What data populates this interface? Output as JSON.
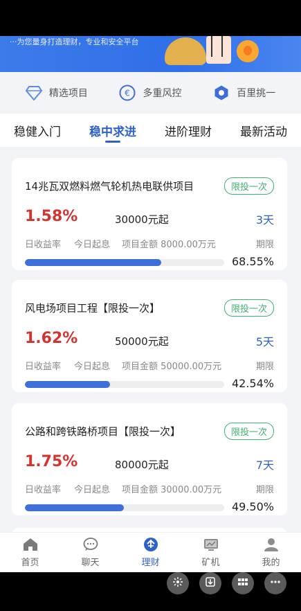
{
  "banner": {
    "text": "···为您量身打造理财，专业和安全平台"
  },
  "features": [
    {
      "label": "精选项目",
      "icon": "diamond-icon"
    },
    {
      "label": "多重风控",
      "icon": "euro-shield-icon"
    },
    {
      "label": "百里挑一",
      "icon": "hexagon-icon"
    }
  ],
  "tabs": [
    {
      "label": "稳健入门",
      "active": false
    },
    {
      "label": "稳中求进",
      "active": true
    },
    {
      "label": "进阶理财",
      "active": false
    },
    {
      "label": "最新活动",
      "active": false
    }
  ],
  "cards": [
    {
      "title": "14兆瓦双燃料燃气轮机热电联供项目",
      "badge": "限投一次",
      "rate": "1.58%",
      "rate_label": "日收益率",
      "amount": "30000元起",
      "start_label": "今日起息",
      "total": "项目金额 8000.00万元",
      "period": "3天",
      "period_label": "期限",
      "progress": 0.6855,
      "percent": "68.55%"
    },
    {
      "title": "风电场项目工程【限投一次】",
      "badge": "限投一次",
      "rate": "1.62%",
      "rate_label": "日收益率",
      "amount": "50000元起",
      "start_label": "今日起息",
      "total": "项目金额 50000.00万元",
      "period": "5天",
      "period_label": "期限",
      "progress": 0.4254,
      "percent": "42.54%"
    },
    {
      "title": "公路和跨铁路桥项目【限投一次】",
      "badge": "限投一次",
      "rate": "1.75%",
      "rate_label": "日收益率",
      "amount": "80000元起",
      "start_label": "今日起息",
      "total": "项目金额 30000.00万元",
      "period": "7天",
      "period_label": "期限",
      "progress": 0.495,
      "percent": "49.50%"
    }
  ],
  "nav": [
    {
      "label": "首页",
      "icon": "home-icon",
      "active": false
    },
    {
      "label": "聊天",
      "icon": "chat-icon",
      "active": false
    },
    {
      "label": "理财",
      "icon": "finance-icon",
      "active": true
    },
    {
      "label": "矿机",
      "icon": "miner-icon",
      "active": false
    },
    {
      "label": "我的",
      "icon": "profile-icon",
      "active": false
    }
  ],
  "floating": [
    {
      "icon": "share-icon"
    },
    {
      "icon": "download-icon"
    },
    {
      "icon": "grid-icon"
    },
    {
      "icon": "more-icon"
    }
  ],
  "colors": {
    "accent": "#2f62c8",
    "rate_red": "#d4342f",
    "badge_green": "#3eb36a",
    "progress": "#3f6fd8"
  }
}
